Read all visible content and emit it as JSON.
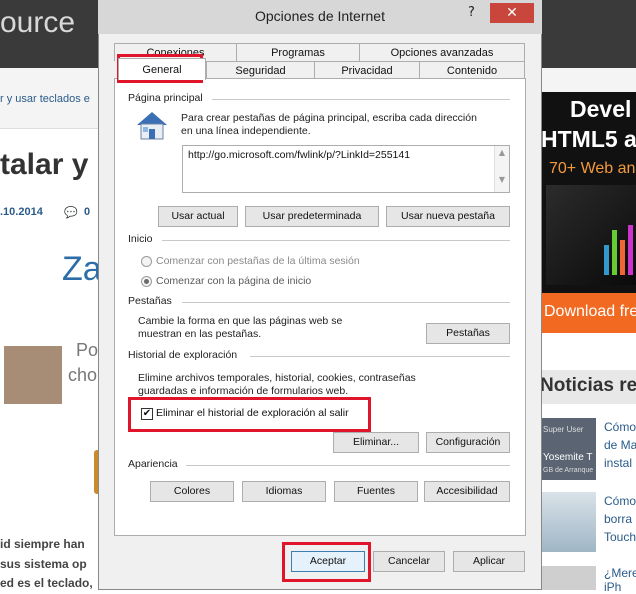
{
  "background_page": {
    "logo": "ource",
    "nav_text": "r y usar teclados e",
    "headline": "talar y",
    "date": ".10.2014",
    "comment_count": "0",
    "za": "Za",
    "po": "Po",
    "cho": "cho",
    "body_line1": "id siempre han",
    "body_line2": "sus sistema op",
    "body_line3": "ed es el teclado,",
    "ad": {
      "line1": "Devel",
      "line2": "HTML5 a",
      "line3": "70+ Web an",
      "button": "Download fre"
    },
    "news_title": "Noticias re",
    "news": [
      {
        "line1": "Cómo",
        "line2": "de Ma",
        "line3": "instal"
      },
      {
        "line1": "Cómo",
        "line2": "borra",
        "line3": "Touch"
      },
      {
        "line1": "¿Mere",
        "line2": "iPh"
      }
    ],
    "thumb1_text1": "Super User",
    "thumb1_text2": "Yosemite T",
    "thumb1_text3": "GB de Arranque"
  },
  "dialog": {
    "title": "Opciones de Internet",
    "help": "?",
    "close": "✕",
    "tabs_row1": [
      "Conexiones",
      "Programas",
      "Opciones avanzadas"
    ],
    "tabs_row2": [
      "General",
      "Seguridad",
      "Privacidad",
      "Contenido"
    ],
    "home": {
      "section": "Página principal",
      "description_line1": "Para crear pestañas de página principal, escriba cada dirección",
      "description_line2": "en una línea independiente.",
      "url": "http://go.microsoft.com/fwlink/p/?LinkId=255141",
      "btn_current": "Usar actual",
      "btn_default": "Usar predeterminada",
      "btn_newtab": "Usar nueva pestaña"
    },
    "startup": {
      "section": "Inicio",
      "option1": "Comenzar con pestañas de la última sesión",
      "option2": "Comenzar con la página de inicio"
    },
    "tabs_section": {
      "section": "Pestañas",
      "description_line1": "Cambie la forma en que las páginas web se",
      "description_line2": "muestran en las pestañas.",
      "button": "Pestañas"
    },
    "history": {
      "section": "Historial de exploración",
      "description_line1": "Elimine archivos temporales, historial, cookies, contraseñas",
      "description_line2": "guardadas e información de formularios web.",
      "checkbox_label": "Eliminar el historial de exploración al salir",
      "checked": true,
      "btn_delete": "Eliminar...",
      "btn_config": "Configuración"
    },
    "appearance": {
      "section": "Apariencia",
      "buttons": [
        "Colores",
        "Idiomas",
        "Fuentes",
        "Accesibilidad"
      ]
    },
    "footer": {
      "ok": "Aceptar",
      "cancel": "Cancelar",
      "apply": "Aplicar"
    }
  },
  "highlight_color": "#e0142b"
}
